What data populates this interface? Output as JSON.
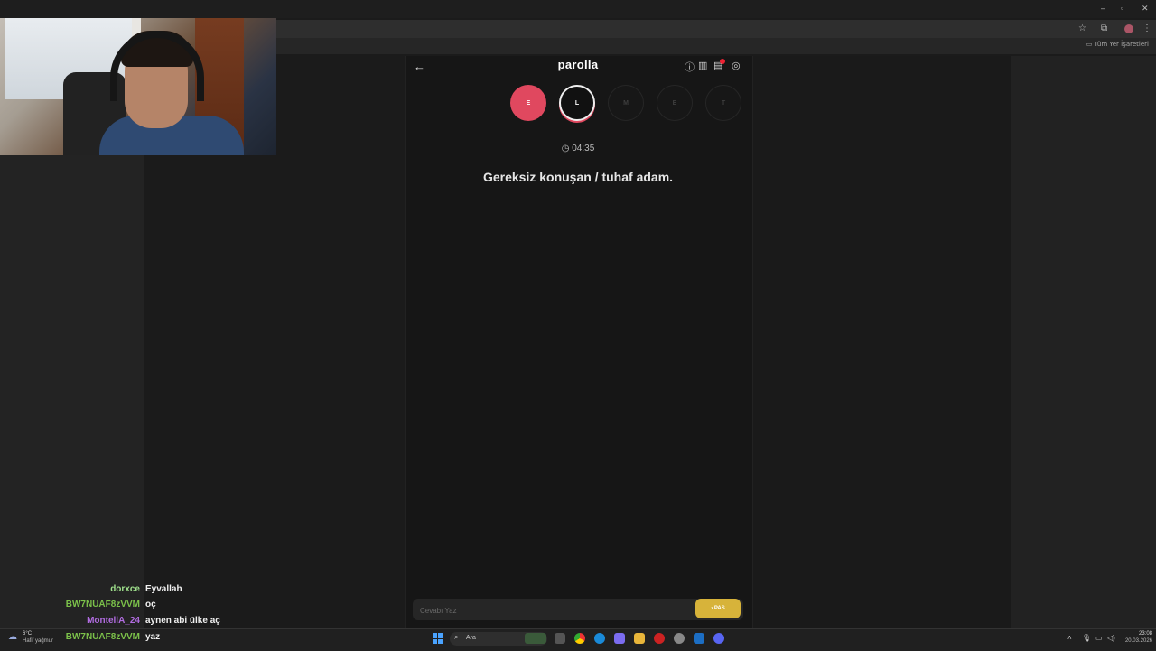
{
  "browser": {
    "bookmark_label": "Tüm Yer İşaretleri",
    "window_controls": {
      "minimize": "–",
      "maximize": "▫",
      "close": "✕"
    }
  },
  "app": {
    "title": "parolla",
    "back_icon": "arrow-left-icon",
    "header_icons": [
      "info-icon",
      "stats-icon",
      "notification-icon",
      "profile-icon"
    ],
    "letters": [
      {
        "letter": "E",
        "state": "answered"
      },
      {
        "letter": "L",
        "state": "active"
      },
      {
        "letter": "M",
        "state": "pending"
      },
      {
        "letter": "E",
        "state": "pending"
      },
      {
        "letter": "T",
        "state": "pending"
      }
    ],
    "timer": "04:35",
    "question": "Gereksiz konuşan / tuhaf adam.",
    "answer_placeholder": "Cevabı Yaz",
    "pass_label": "PAS",
    "accent_color": "#e0485f",
    "pass_color": "#d7b33a"
  },
  "chat": [
    {
      "user": "dorxce",
      "color": "#9fe08c",
      "message": "Eyvallah"
    },
    {
      "user": "BW7NUAF8zVVM",
      "color": "#7cc24a",
      "message": "oç"
    },
    {
      "user": "MontellA_24",
      "color": "#b16ce0",
      "message": "aynen abi ülke aç"
    },
    {
      "user": "BW7NUAF8zVVM",
      "color": "#7cc24a",
      "message": "yaz"
    }
  ],
  "taskbar": {
    "weather_temp": "6°C",
    "weather_desc": "Hafif yağmur",
    "search_label": "Ara",
    "time": "23:08",
    "date": "20.03.2026"
  }
}
